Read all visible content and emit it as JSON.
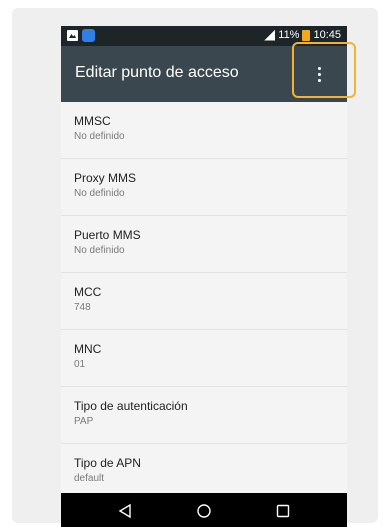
{
  "status_bar": {
    "battery_text": "11%",
    "time_text": "10:45",
    "icons": [
      "image-icon",
      "app-icon",
      "signal-icon",
      "battery-icon"
    ]
  },
  "app_bar": {
    "title": "Editar punto de acceso",
    "overflow_icon": "more-vert-icon"
  },
  "settings": [
    {
      "label": "MMSC",
      "value": "No definido"
    },
    {
      "label": "Proxy MMS",
      "value": "No definido"
    },
    {
      "label": "Puerto MMS",
      "value": "No definido"
    },
    {
      "label": "MCC",
      "value": "748"
    },
    {
      "label": "MNC",
      "value": "01"
    },
    {
      "label": "Tipo de autenticación",
      "value": "PAP"
    },
    {
      "label": "Tipo de APN",
      "value": "default"
    }
  ],
  "nav_bar": {
    "icons": [
      "back-icon",
      "home-icon",
      "recents-icon"
    ]
  },
  "colors": {
    "app_bar": "#3a474e",
    "status_bar": "#1d2529",
    "highlight": "#f2b233"
  }
}
